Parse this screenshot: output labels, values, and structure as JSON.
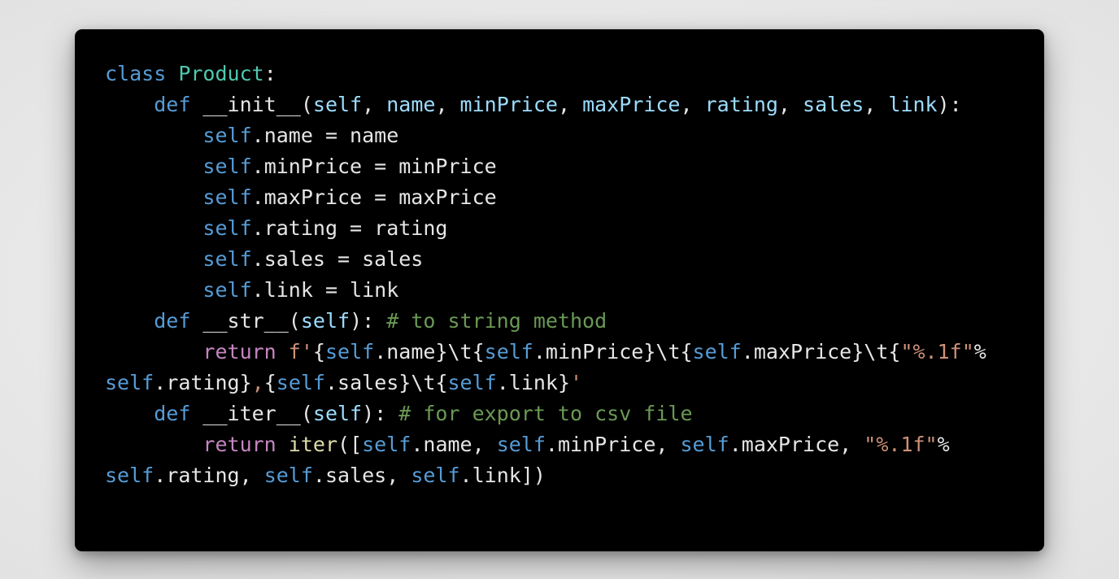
{
  "colors": {
    "background": "#ebebeb",
    "panel": "#000000",
    "plain": "#e6e6e6",
    "keyword": "#569cd6",
    "control": "#c586c0",
    "class_name": "#4ec9b0",
    "param": "#9cdcfe",
    "function": "#dcdcaa",
    "string": "#ce9178",
    "comment": "#6a9955"
  },
  "code_lines": [
    [
      {
        "t": "class",
        "c": "keyword"
      },
      {
        "t": " ",
        "c": "plain"
      },
      {
        "t": "Product",
        "c": "class_name"
      },
      {
        "t": ":",
        "c": "plain"
      }
    ],
    [
      {
        "t": "    ",
        "c": "plain"
      },
      {
        "t": "def",
        "c": "keyword"
      },
      {
        "t": " __init__(",
        "c": "plain"
      },
      {
        "t": "self",
        "c": "param"
      },
      {
        "t": ", ",
        "c": "plain"
      },
      {
        "t": "name",
        "c": "param"
      },
      {
        "t": ", ",
        "c": "plain"
      },
      {
        "t": "minPrice",
        "c": "param"
      },
      {
        "t": ", ",
        "c": "plain"
      },
      {
        "t": "maxPrice",
        "c": "param"
      },
      {
        "t": ", ",
        "c": "plain"
      },
      {
        "t": "rating",
        "c": "param"
      },
      {
        "t": ", ",
        "c": "plain"
      },
      {
        "t": "sales",
        "c": "param"
      },
      {
        "t": ", ",
        "c": "plain"
      },
      {
        "t": "link",
        "c": "param"
      },
      {
        "t": "):",
        "c": "plain"
      }
    ],
    [
      {
        "t": "        ",
        "c": "plain"
      },
      {
        "t": "self",
        "c": "keyword"
      },
      {
        "t": ".name = name",
        "c": "plain"
      }
    ],
    [
      {
        "t": "        ",
        "c": "plain"
      },
      {
        "t": "self",
        "c": "keyword"
      },
      {
        "t": ".minPrice = minPrice",
        "c": "plain"
      }
    ],
    [
      {
        "t": "        ",
        "c": "plain"
      },
      {
        "t": "self",
        "c": "keyword"
      },
      {
        "t": ".maxPrice = maxPrice",
        "c": "plain"
      }
    ],
    [
      {
        "t": "        ",
        "c": "plain"
      },
      {
        "t": "self",
        "c": "keyword"
      },
      {
        "t": ".rating = rating",
        "c": "plain"
      }
    ],
    [
      {
        "t": "        ",
        "c": "plain"
      },
      {
        "t": "self",
        "c": "keyword"
      },
      {
        "t": ".sales = sales",
        "c": "plain"
      }
    ],
    [
      {
        "t": "        ",
        "c": "plain"
      },
      {
        "t": "self",
        "c": "keyword"
      },
      {
        "t": ".link = link",
        "c": "plain"
      }
    ],
    [
      {
        "t": "    ",
        "c": "plain"
      },
      {
        "t": "def",
        "c": "keyword"
      },
      {
        "t": " __str__(",
        "c": "plain"
      },
      {
        "t": "self",
        "c": "param"
      },
      {
        "t": "): ",
        "c": "plain"
      },
      {
        "t": "# to string method",
        "c": "comment"
      }
    ],
    [
      {
        "t": "        ",
        "c": "plain"
      },
      {
        "t": "return",
        "c": "control"
      },
      {
        "t": " ",
        "c": "plain"
      },
      {
        "t": "f'",
        "c": "string"
      },
      {
        "t": "{",
        "c": "plain"
      },
      {
        "t": "self",
        "c": "keyword"
      },
      {
        "t": ".name}\\t{",
        "c": "plain"
      },
      {
        "t": "self",
        "c": "keyword"
      },
      {
        "t": ".minPrice}\\t{",
        "c": "plain"
      },
      {
        "t": "self",
        "c": "keyword"
      },
      {
        "t": ".maxPrice}\\t{",
        "c": "plain"
      },
      {
        "t": "\"%.1f\"",
        "c": "string"
      },
      {
        "t": "%",
        "c": "plain"
      }
    ],
    [
      {
        "t": "self",
        "c": "keyword"
      },
      {
        "t": ".rating}",
        "c": "plain"
      },
      {
        "t": ",",
        "c": "string"
      },
      {
        "t": "{",
        "c": "plain"
      },
      {
        "t": "self",
        "c": "keyword"
      },
      {
        "t": ".sales}\\t{",
        "c": "plain"
      },
      {
        "t": "self",
        "c": "keyword"
      },
      {
        "t": ".link}",
        "c": "plain"
      },
      {
        "t": "'",
        "c": "string"
      }
    ],
    [
      {
        "t": "    ",
        "c": "plain"
      },
      {
        "t": "def",
        "c": "keyword"
      },
      {
        "t": " __iter__(",
        "c": "plain"
      },
      {
        "t": "self",
        "c": "param"
      },
      {
        "t": "): ",
        "c": "plain"
      },
      {
        "t": "# for export to csv file",
        "c": "comment"
      }
    ],
    [
      {
        "t": "        ",
        "c": "plain"
      },
      {
        "t": "return",
        "c": "control"
      },
      {
        "t": " ",
        "c": "plain"
      },
      {
        "t": "iter",
        "c": "function"
      },
      {
        "t": "([",
        "c": "plain"
      },
      {
        "t": "self",
        "c": "keyword"
      },
      {
        "t": ".name, ",
        "c": "plain"
      },
      {
        "t": "self",
        "c": "keyword"
      },
      {
        "t": ".minPrice, ",
        "c": "plain"
      },
      {
        "t": "self",
        "c": "keyword"
      },
      {
        "t": ".maxPrice, ",
        "c": "plain"
      },
      {
        "t": "\"%.1f\"",
        "c": "string"
      },
      {
        "t": "%",
        "c": "plain"
      }
    ],
    [
      {
        "t": "self",
        "c": "keyword"
      },
      {
        "t": ".rating, ",
        "c": "plain"
      },
      {
        "t": "self",
        "c": "keyword"
      },
      {
        "t": ".sales, ",
        "c": "plain"
      },
      {
        "t": "self",
        "c": "keyword"
      },
      {
        "t": ".link])",
        "c": "plain"
      }
    ]
  ]
}
